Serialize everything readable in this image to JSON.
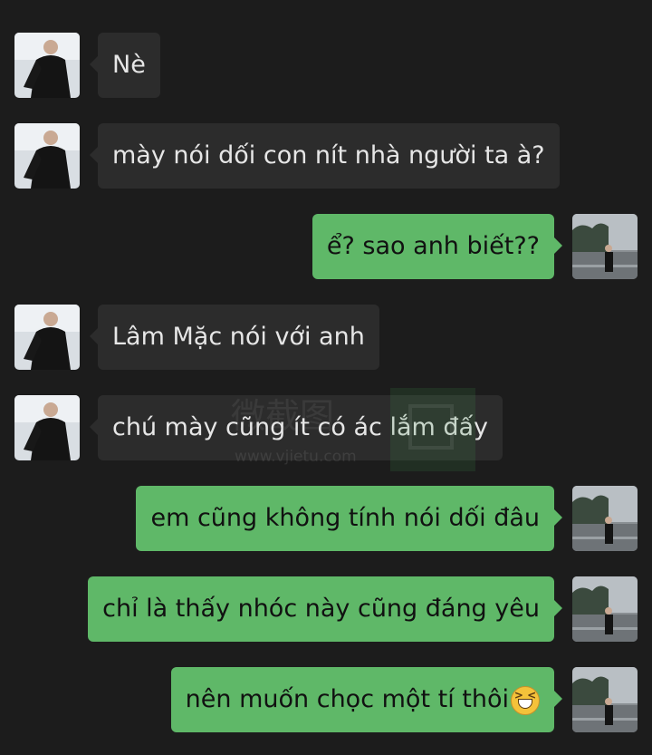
{
  "messages": [
    {
      "side": "left",
      "text": "Nè"
    },
    {
      "side": "left",
      "text": "mày nói dối con nít nhà người ta à?"
    },
    {
      "side": "right",
      "text": "ể? sao anh biết??"
    },
    {
      "side": "left",
      "text": "Lâm Mặc nói với anh"
    },
    {
      "side": "left",
      "text": "chú mày cũng ít có ác lắm đấy"
    },
    {
      "side": "right",
      "text": "em cũng không tính nói dối đâu"
    },
    {
      "side": "right",
      "text": "chỉ là thấy nhóc này cũng đáng yêu"
    },
    {
      "side": "right",
      "text": "nên muốn chọc một tí thôi",
      "emoji": "grinning-squinting-face-icon"
    }
  ],
  "watermark": {
    "text": "微截图",
    "url": "www.vjietu.com"
  },
  "colors": {
    "background": "#1c1c1c",
    "incoming_bubble": "#2c2c2c",
    "outgoing_bubble": "#5fb868",
    "incoming_text": "#e6e6e6",
    "outgoing_text": "#111111"
  }
}
